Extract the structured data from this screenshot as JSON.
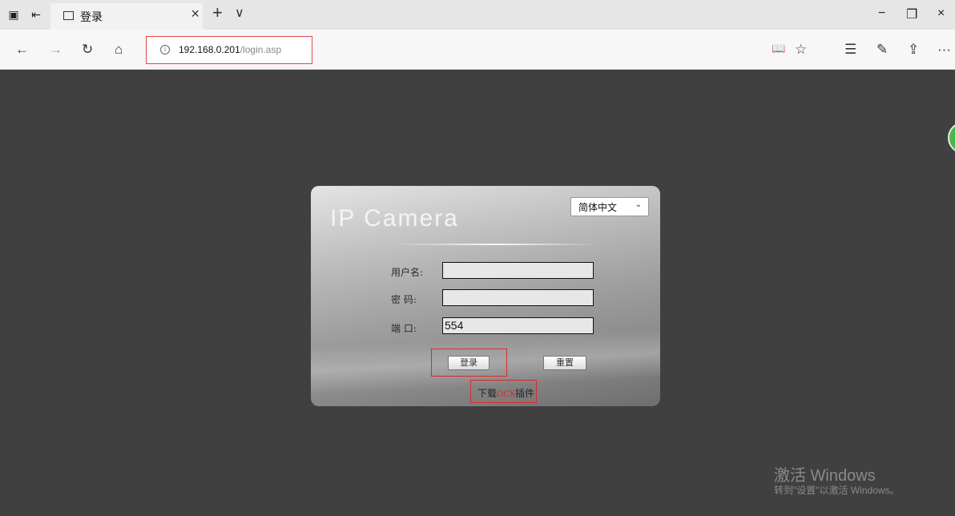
{
  "browser": {
    "tab": {
      "title": "登录",
      "close": "×"
    },
    "new_tab": "+",
    "tab_dropdown": "∨",
    "window_controls": {
      "minimize": "−",
      "restore": "❐",
      "close": "×"
    },
    "nav_icons": {
      "back": "←",
      "forward": "→",
      "refresh": "↻",
      "home": "⌂"
    },
    "address": {
      "host": "192.168.0.201",
      "path": "/login.asp"
    },
    "toolbar_icons": {
      "reading_view": "📖",
      "favorite": "☆",
      "favorites_list": "☰",
      "pen": "✎",
      "share": "⇪",
      "more": "···"
    }
  },
  "login": {
    "title": "IP Camera",
    "language": {
      "selected": "简体中文"
    },
    "username": {
      "label": "用户名:",
      "value": ""
    },
    "password": {
      "label": "密  码:",
      "value": ""
    },
    "port": {
      "label": "端  口:",
      "value": "554"
    },
    "login_button": "登录",
    "reset_button": "重置",
    "download": {
      "prefix": "下载",
      "highlight": "OCX",
      "suffix": "插件"
    }
  },
  "watermark": {
    "line1": "激活 Windows",
    "line2": "转到\"设置\"以激活 Windows。"
  },
  "colors": {
    "page_bg": "#404040",
    "highlight_red": "#e02828"
  }
}
